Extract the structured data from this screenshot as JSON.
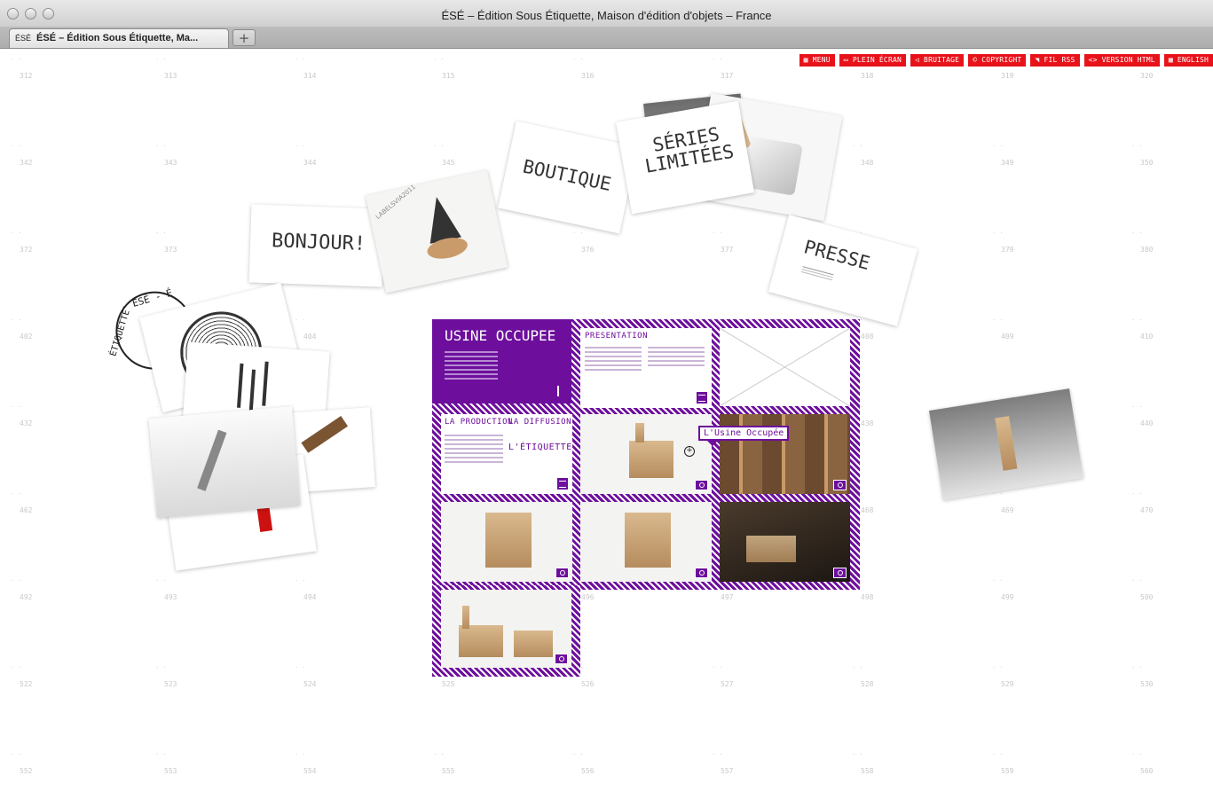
{
  "window": {
    "title": "ÉSÉ – Édition Sous Étiquette, Maison d'édition d'objets – France",
    "tab_label": "ÉSÉ – Édition Sous Étiquette, Ma...",
    "tab_favicon": "ÉSÉ",
    "newtab_label": "+"
  },
  "menu": [
    {
      "icon": "grid-icon",
      "label": "MENU"
    },
    {
      "icon": "fullscreen-icon",
      "label": "PLEIN ÉCRAN"
    },
    {
      "icon": "sound-icon",
      "label": "BRUITAGE"
    },
    {
      "icon": "copyright-icon",
      "label": "COPYRIGHT"
    },
    {
      "icon": "rss-icon",
      "label": "FIL RSS"
    },
    {
      "icon": "code-icon",
      "label": "VERSION HTML"
    },
    {
      "icon": "flag-icon",
      "label": "ENGLISH"
    }
  ],
  "grid_numbers": [
    [
      "312",
      "313",
      "314",
      "315",
      "316",
      "317",
      "318",
      "319",
      "320"
    ],
    [
      "342",
      "343",
      "344",
      "345",
      "",
      "",
      "348",
      "349",
      "350"
    ],
    [
      "372",
      "373",
      "",
      "",
      "376",
      "377",
      "",
      "379",
      "380"
    ],
    [
      "402",
      "",
      "404",
      "",
      "",
      "",
      "408",
      "409",
      "410"
    ],
    [
      "432",
      "433",
      "",
      "",
      "",
      "",
      "438",
      "",
      "440"
    ],
    [
      "462",
      "",
      "4",
      "",
      "",
      "",
      "468",
      "469",
      "470"
    ],
    [
      "492",
      "493",
      "494",
      "",
      "496",
      "497",
      "498",
      "499",
      "500"
    ],
    [
      "522",
      "523",
      "524",
      "525",
      "526",
      "527",
      "528",
      "529",
      "530"
    ],
    [
      "552",
      "553",
      "554",
      "555",
      "556",
      "557",
      "558",
      "559",
      "560"
    ]
  ],
  "cards": {
    "bonjour": "BONJOUR!",
    "boutique": "BOUTIQUE",
    "series_1": "SÉRIES",
    "series_2": "LIMITÉES",
    "presse": "PRESSE",
    "labels_tag": "LABELSVIA2011",
    "stamp": "- ÉSÉ - É",
    "stamp_2": "ÉTIQUETTE"
  },
  "mosaic": {
    "title": "USINE OCCUPEE",
    "presentation": "PRESENTATION",
    "production": "LA PRODUCTION",
    "diffusion": "LA DIFFUSION",
    "etiquette": "L'ÉTIQUETTE",
    "tooltip": "L'Usine Occupée"
  }
}
